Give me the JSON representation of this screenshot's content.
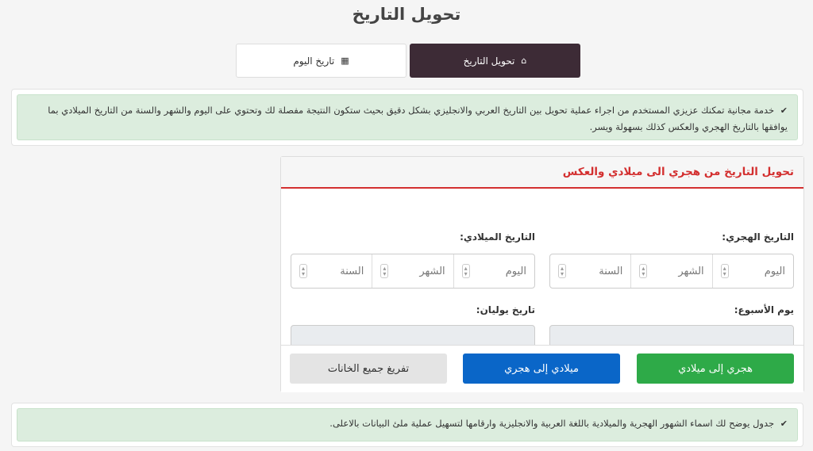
{
  "page": {
    "title": "تحويل التاريخ"
  },
  "tabs": [
    {
      "label": "تحويل التاريخ",
      "icon": "home-icon",
      "active": true
    },
    {
      "label": "تاريخ اليوم",
      "icon": "calendar-icon",
      "active": false
    }
  ],
  "intro": {
    "text": "خدمة مجانية تمكنك عزيزي المستخدم من اجراء عملية تحويل بين التاريخ العربي والانجليزي بشكل دقيق بحيث ستكون النتيجة مفصلة لك وتحتوي على اليوم والشهر والسنة من التاريخ الميلادي بما يوافقها بالتاريخ الهجري والعكس كذلك بسهولة ويسر."
  },
  "converter": {
    "title": "تحويل التاريخ من هجري الى ميلادي والعكس",
    "hijri": {
      "label": "التاريخ الهجري:",
      "day_placeholder": "اليوم",
      "month_placeholder": "الشهر",
      "year_placeholder": "السنة"
    },
    "gregorian": {
      "label": "التاريخ الميلادي:",
      "day_placeholder": "اليوم",
      "month_placeholder": "الشهر",
      "year_placeholder": "السنة"
    },
    "weekday_label": "يوم الأسبوع:",
    "julian_label": "تاريخ يوليان:",
    "buttons": {
      "hijri_to_gregorian": "هجري إلى ميلادي",
      "gregorian_to_hijri": "ميلادي إلى هجري",
      "clear_all": "تفريغ جميع الخانات"
    }
  },
  "note": {
    "text": "جدول يوضح لك اسماء الشهور الهجرية والميلادية باللغة العربية والانجليزية وارقامها لتسهيل عملية ملئ البيانات بالاعلى."
  },
  "colors": {
    "tab_active": "#3d2b36",
    "alert_bg": "#dcedde",
    "accent_red": "#d32f2f",
    "btn_green": "#2eaa48",
    "btn_blue": "#0a66c8"
  }
}
